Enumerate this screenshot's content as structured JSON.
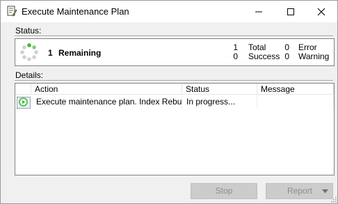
{
  "window": {
    "title": "Execute Maintenance Plan",
    "icons": [
      "plan-icon",
      "minimize-icon",
      "maximize-icon",
      "close-icon"
    ]
  },
  "status": {
    "section_label": "Status:",
    "remaining_count": "1",
    "remaining_label": "Remaining",
    "total_count": "1",
    "total_label": "Total",
    "success_count": "0",
    "success_label": "Success",
    "error_count": "0",
    "error_label": "Error",
    "warning_count": "0",
    "warning_label": "Warning"
  },
  "details": {
    "section_label": "Details:",
    "columns": [
      "Action",
      "Status",
      "Message"
    ],
    "rows": [
      {
        "icon": "running-icon",
        "action": "Execute maintenance plan. Index Rebuil...",
        "status": "In progress...",
        "message": ""
      }
    ]
  },
  "buttons": {
    "stop_label": "Stop",
    "report_label": "Report"
  },
  "colors": {
    "accent_green": "#3db83d",
    "disabled_button": "#cccccc",
    "disabled_text": "#8d8d8d"
  }
}
